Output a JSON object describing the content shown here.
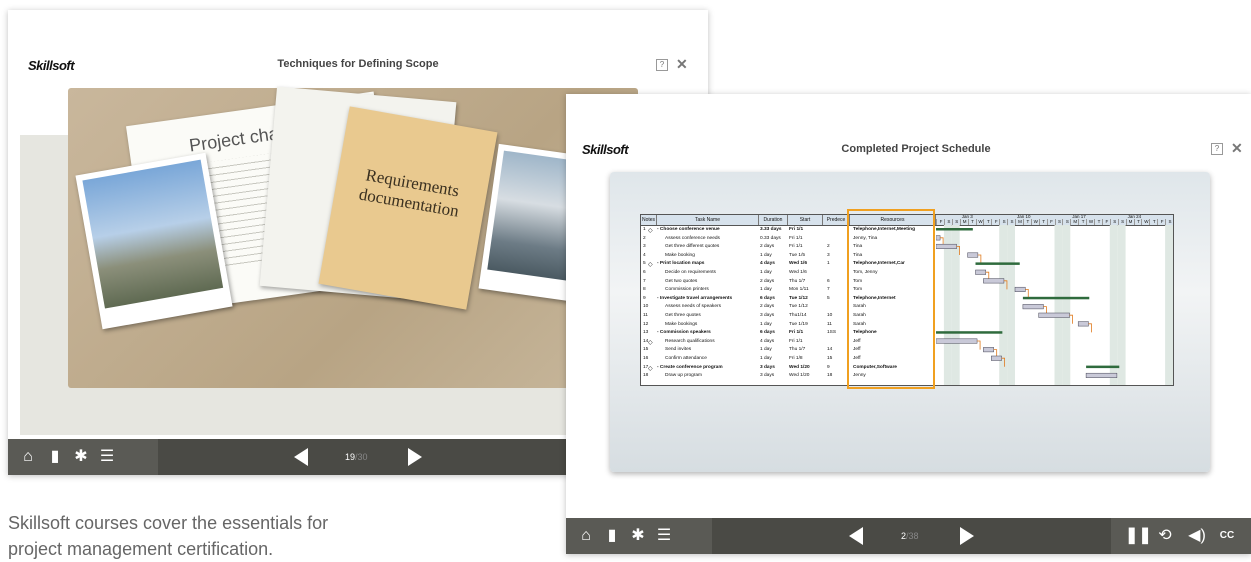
{
  "left_window": {
    "logo": "Skillsoft",
    "title": "Techniques for Defining Scope",
    "help": "?",
    "close": "✕",
    "scene": {
      "charter_title": "Project charter",
      "folder_text": "Requirements documentation"
    },
    "page_current": "19",
    "page_total": "/30"
  },
  "right_window": {
    "logo": "Skillsoft",
    "title": "Completed Project Schedule",
    "help": "?",
    "close": "✕",
    "page_current": "2",
    "page_total": "/38",
    "cc": "CC",
    "gantt": {
      "headers": [
        "Notes",
        "Task Name",
        "Duration",
        "Start",
        "Predece",
        "Resources"
      ],
      "weeks": [
        "Jan 3",
        "Jan 10",
        "Jan 17",
        "Jan 24"
      ],
      "day_letters": [
        "F",
        "S",
        "S",
        "M",
        "T",
        "W",
        "T",
        "F",
        "S",
        "S",
        "M",
        "T",
        "W",
        "T",
        "F",
        "S",
        "S",
        "M",
        "T",
        "W",
        "T",
        "F",
        "S",
        "S",
        "M",
        "T",
        "W",
        "T",
        "F",
        "S"
      ],
      "rows": [
        {
          "id": "1",
          "task": "- Choose conference venue",
          "dur": "3.33 days",
          "start": "Fri 1/1",
          "pred": "",
          "res": "Telephone,Internet,Meeting",
          "bold": true,
          "note": true
        },
        {
          "id": "2",
          "task": "Assess conference needs",
          "dur": "0.33 days",
          "start": "Fri 1/1",
          "pred": "",
          "res": "Jenny, Tina",
          "bold": false,
          "note": false
        },
        {
          "id": "3",
          "task": "Get three different quotes",
          "dur": "2 days",
          "start": "Fri 1/1",
          "pred": "2",
          "res": "Tina",
          "bold": false,
          "note": false
        },
        {
          "id": "4",
          "task": "Make booking",
          "dur": "1 day",
          "start": "Tue 1/5",
          "pred": "3",
          "res": "Tina",
          "bold": false,
          "note": false
        },
        {
          "id": "5",
          "task": "- Print location maps",
          "dur": "4 days",
          "start": "Wed 1/6",
          "pred": "1",
          "res": "Telephone,Internet,Car",
          "bold": true,
          "note": true
        },
        {
          "id": "6",
          "task": "Decide on requirements",
          "dur": "1 day",
          "start": "Wed 1/6",
          "pred": "",
          "res": "Tom, Jenny",
          "bold": false,
          "note": false
        },
        {
          "id": "7",
          "task": "Get two quotes",
          "dur": "2 days",
          "start": "Thu 1/7",
          "pred": "6",
          "res": "Tom",
          "bold": false,
          "note": false
        },
        {
          "id": "8",
          "task": "Commission printers",
          "dur": "1 day",
          "start": "Mon 1/11",
          "pred": "7",
          "res": "Tom",
          "bold": false,
          "note": false
        },
        {
          "id": "9",
          "task": "- Investigate travel arrangements",
          "dur": "6 days",
          "start": "Tue 1/12",
          "pred": "5",
          "res": "Telephone,Internet",
          "bold": true,
          "note": false
        },
        {
          "id": "10",
          "task": "Assess needs of speakers",
          "dur": "2 days",
          "start": "Tue 1/12",
          "pred": "",
          "res": "Sarah",
          "bold": false,
          "note": false
        },
        {
          "id": "11",
          "task": "Get three quotes",
          "dur": "3 days",
          "start": "Thu1/14",
          "pred": "10",
          "res": "Sarah",
          "bold": false,
          "note": false
        },
        {
          "id": "12",
          "task": "Make bookings",
          "dur": "1 day",
          "start": "Tue 1/19",
          "pred": "11",
          "res": "Sarah",
          "bold": false,
          "note": false
        },
        {
          "id": "13",
          "task": "- Commission speakers",
          "dur": "6 days",
          "start": "Fri 1/1",
          "pred": "1SS",
          "res": "Telephone",
          "bold": true,
          "note": false
        },
        {
          "id": "14",
          "task": "Research qualifications",
          "dur": "4 days",
          "start": "Fri 1/1",
          "pred": "",
          "res": "Jeff",
          "bold": false,
          "note": true
        },
        {
          "id": "15",
          "task": "Send invites",
          "dur": "1 day",
          "start": "Thu 1/7",
          "pred": "14",
          "res": "Jeff",
          "bold": false,
          "note": false
        },
        {
          "id": "16",
          "task": "Confirm attendance",
          "dur": "1 day",
          "start": "Fri 1/8",
          "pred": "15",
          "res": "Jeff",
          "bold": false,
          "note": false
        },
        {
          "id": "17",
          "task": "- Create conference program",
          "dur": "3 days",
          "start": "Wed 1/20",
          "pred": "9",
          "res": "Computer,Software",
          "bold": true,
          "note": true
        },
        {
          "id": "18",
          "task": "Draw up program",
          "dur": "3 days",
          "start": "Wed 1/20",
          "pred": "18",
          "res": "Jenny",
          "bold": false,
          "note": false
        }
      ]
    }
  },
  "caption": "Skillsoft courses cover the essentials for project management certification.",
  "colors": {
    "toolbar": "#4a4a45",
    "accent": "#e07b1f",
    "highlight": "#f0a020"
  }
}
